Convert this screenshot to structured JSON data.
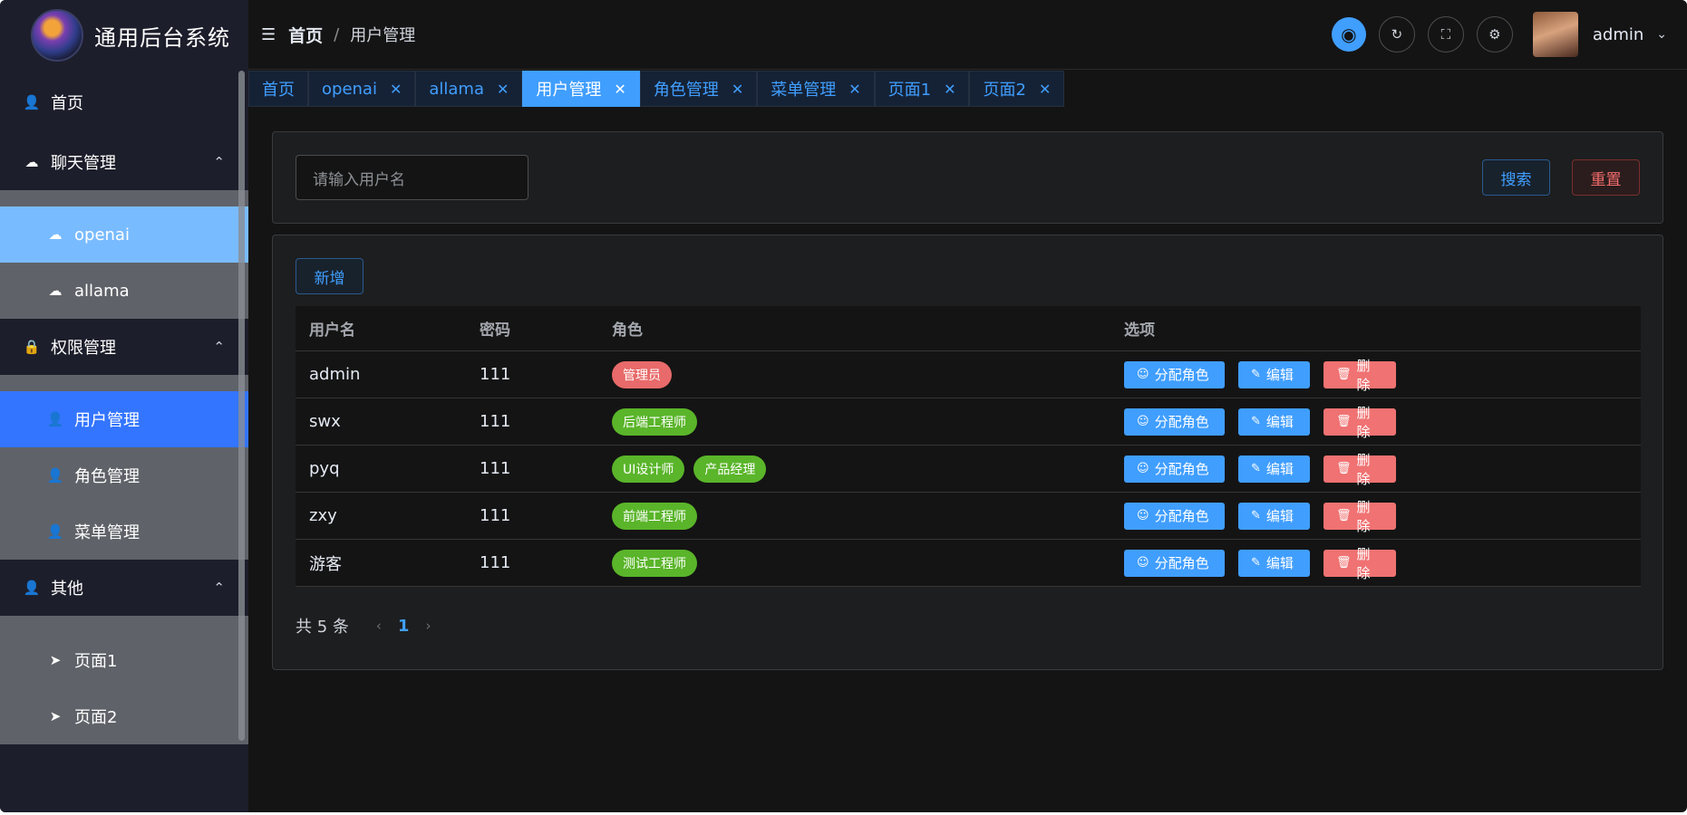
{
  "app": {
    "title": "通用后台系统"
  },
  "sidebar": {
    "items": [
      {
        "label": "首页"
      },
      {
        "label": "聊天管理",
        "children": [
          {
            "label": "openai"
          },
          {
            "label": "allama"
          }
        ]
      },
      {
        "label": "权限管理",
        "children": [
          {
            "label": "用户管理"
          },
          {
            "label": "角色管理"
          },
          {
            "label": "菜单管理"
          }
        ]
      },
      {
        "label": "其他",
        "children": [
          {
            "label": "页面1"
          },
          {
            "label": "页面2"
          }
        ]
      }
    ]
  },
  "header": {
    "breadcrumb_home": "首页",
    "breadcrumb_sep": "/",
    "breadcrumb_current": "用户管理",
    "user_name": "admin"
  },
  "tabs": [
    {
      "label": "首页"
    },
    {
      "label": "openai"
    },
    {
      "label": "allama"
    },
    {
      "label": "用户管理"
    },
    {
      "label": "角色管理"
    },
    {
      "label": "菜单管理"
    },
    {
      "label": "页面1"
    },
    {
      "label": "页面2"
    }
  ],
  "search": {
    "placeholder": "请输入用户名",
    "search_label": "搜索",
    "reset_label": "重置"
  },
  "table": {
    "add_label": "新增",
    "columns": [
      "用户名",
      "密码",
      "角色",
      "选项"
    ],
    "rows": [
      {
        "username": "admin",
        "password": "111",
        "roles": [
          "管理员"
        ]
      },
      {
        "username": "swx",
        "password": "111",
        "roles": [
          "后端工程师"
        ]
      },
      {
        "username": "pyq",
        "password": "111",
        "roles": [
          "UI设计师",
          "产品经理"
        ]
      },
      {
        "username": "zxy",
        "password": "111",
        "roles": [
          "前端工程师"
        ]
      },
      {
        "username": "游客",
        "password": "111",
        "roles": [
          "测试工程师"
        ]
      }
    ],
    "actions": {
      "assign": "分配角色",
      "edit": "编辑",
      "delete": "删除"
    }
  },
  "pagination": {
    "total_text": "共 5 条",
    "current_page": "1"
  },
  "colors": {
    "accent": "#409eff",
    "danger": "#f56c6c",
    "success": "#5ab52a",
    "sidebar_bg": "#1d1e2b",
    "submenu_bg": "#5f6268"
  }
}
